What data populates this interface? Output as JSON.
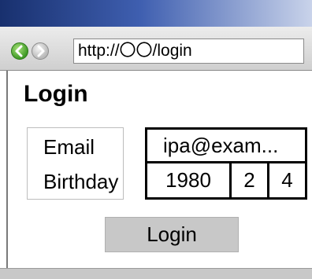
{
  "browser": {
    "address": "http://〇〇/login",
    "back_icon": "back-arrow-icon",
    "forward_icon": "forward-arrow-icon",
    "colors": {
      "back": "#3f9a26",
      "forward": "#b8b8b8",
      "title_bar": "#18306e"
    }
  },
  "page": {
    "title": "Login",
    "email_label": "Email",
    "birthday_label": "Birthday",
    "email_value": "ipa@exam...",
    "birth_year": "1980",
    "birth_month": "2",
    "birth_day": "4",
    "login_label": "Login"
  }
}
